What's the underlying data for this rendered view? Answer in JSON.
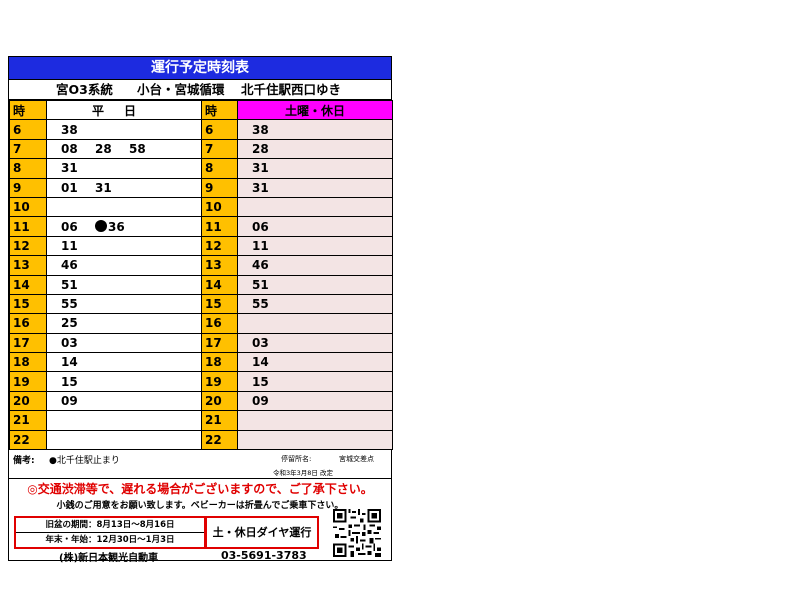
{
  "title": "運行予定時刻表",
  "route": {
    "system": "宮O3系統",
    "via": "小台・宮城循環",
    "dest": "北千住駅西口ゆき"
  },
  "header": {
    "hour": "時",
    "weekday": "平日",
    "weekend": "土曜・休日"
  },
  "rows": [
    {
      "hour": "6",
      "weekday": [
        "38"
      ],
      "weekend": [
        "38"
      ]
    },
    {
      "hour": "7",
      "weekday": [
        "08",
        "28",
        "58"
      ],
      "weekend": [
        "28"
      ]
    },
    {
      "hour": "8",
      "weekday": [
        "31"
      ],
      "weekend": [
        "31"
      ]
    },
    {
      "hour": "9",
      "weekday": [
        "01",
        "31"
      ],
      "weekend": [
        "31"
      ]
    },
    {
      "hour": "10",
      "weekday": [],
      "weekend": []
    },
    {
      "hour": "11",
      "weekday": [
        "06",
        "●36"
      ],
      "weekend": [
        "06"
      ]
    },
    {
      "hour": "12",
      "weekday": [
        "11"
      ],
      "weekend": [
        "11"
      ]
    },
    {
      "hour": "13",
      "weekday": [
        "46"
      ],
      "weekend": [
        "46"
      ]
    },
    {
      "hour": "14",
      "weekday": [
        "51"
      ],
      "weekend": [
        "51"
      ]
    },
    {
      "hour": "15",
      "weekday": [
        "55"
      ],
      "weekend": [
        "55"
      ]
    },
    {
      "hour": "16",
      "weekday": [
        "25"
      ],
      "weekend": []
    },
    {
      "hour": "17",
      "weekday": [
        "03"
      ],
      "weekend": [
        "03"
      ]
    },
    {
      "hour": "18",
      "weekday": [
        "14"
      ],
      "weekend": [
        "14"
      ]
    },
    {
      "hour": "19",
      "weekday": [
        "15"
      ],
      "weekend": [
        "15"
      ]
    },
    {
      "hour": "20",
      "weekday": [
        "09"
      ],
      "weekend": [
        "09"
      ]
    },
    {
      "hour": "21",
      "weekday": [],
      "weekend": []
    },
    {
      "hour": "22",
      "weekday": [],
      "weekend": []
    }
  ],
  "notes": {
    "label": "備考:",
    "text": "●北千住駅止まり",
    "stop_label": "停留所名:",
    "stop_name": "宮城交差点",
    "revised": "令和3年3月8日 改定"
  },
  "warning": "◎交通渋滞等で、遅れる場合がございますので、ご了承下さい。",
  "warning_sub": "小銭のご用意をお願い致します。ベビーカーは折畳んでご乗車下さい。",
  "period": {
    "obon": "旧盆の期間：8月13日～8月16日",
    "newyear": "年末・年始：12月30日～1月3日"
  },
  "dia_note": "土・休日ダイヤ運行",
  "company": "(株)新日本観光自動車",
  "phone": "03-5691-3783",
  "colors": {
    "title_bg": "#1d2be0",
    "hour_bg": "#ffc000",
    "weekend_header_bg": "#ff00ff",
    "weekend_cell_bg": "#f3e4e4",
    "warning": "#e00000"
  },
  "icons": {
    "terminus_marker": "filled-circle",
    "qr_code": "qr-code-icon"
  }
}
